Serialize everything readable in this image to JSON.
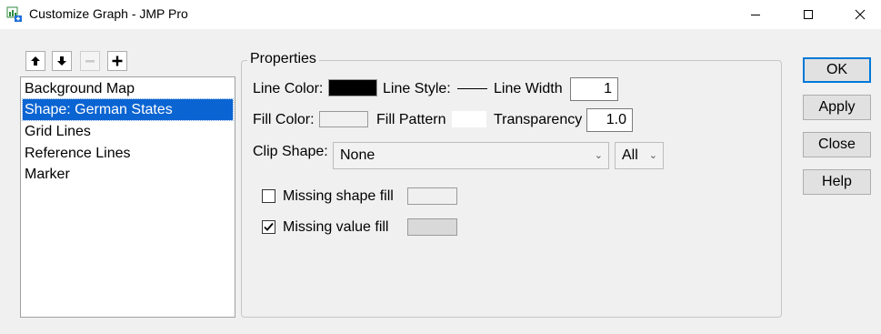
{
  "window": {
    "title": "Customize Graph - JMP Pro",
    "minimize_icon": "minimize-icon",
    "maximize_icon": "maximize-icon",
    "close_icon": "close-icon"
  },
  "toolbar": {
    "move_up_icon": "arrow-up-icon",
    "move_down_icon": "arrow-down-icon",
    "remove_icon": "minus-icon",
    "add_icon": "plus-icon"
  },
  "list": {
    "items": [
      {
        "label": "Background Map",
        "selected": false
      },
      {
        "label": "Shape: German States",
        "selected": true
      },
      {
        "label": "Grid Lines",
        "selected": false
      },
      {
        "label": "Reference Lines",
        "selected": false
      },
      {
        "label": "Marker",
        "selected": false
      }
    ]
  },
  "properties": {
    "title": "Properties",
    "line_color_label": "Line Color:",
    "line_color": "#000000",
    "line_style_label": "Line Style:",
    "line_width_label": "Line Width",
    "line_width_value": "1",
    "fill_color_label": "Fill Color:",
    "fill_color": "#f0f0f0",
    "fill_pattern_label": "Fill Pattern",
    "transparency_label": "Transparency",
    "transparency_value": "1.0",
    "clip_shape_label": "Clip Shape:",
    "clip_shape_value": "None",
    "clip_scope_value": "All",
    "missing_shape_fill_label": "Missing shape fill",
    "missing_shape_fill_checked": false,
    "missing_value_fill_label": "Missing value fill",
    "missing_value_fill_checked": true,
    "missing_value_fill_color": "#d9d9d9"
  },
  "buttons": {
    "ok": "OK",
    "apply": "Apply",
    "close": "Close",
    "help": "Help"
  }
}
